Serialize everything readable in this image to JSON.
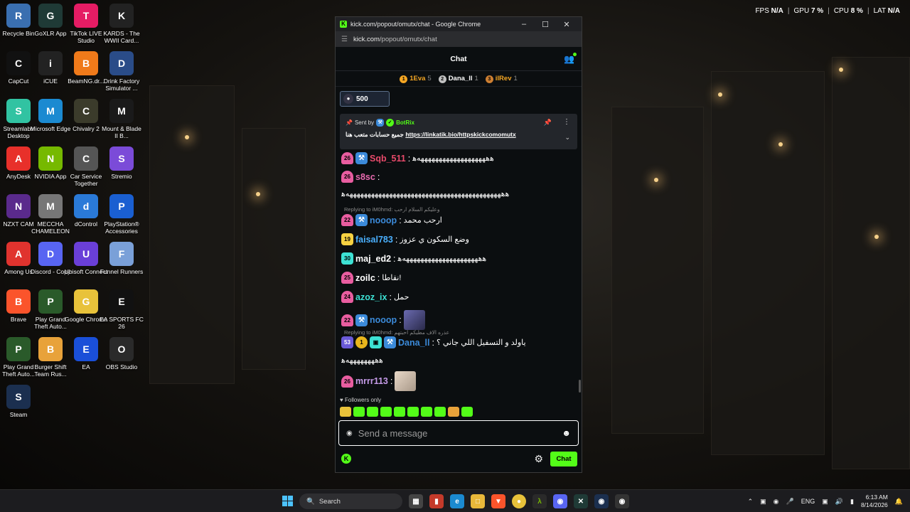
{
  "performance": {
    "fps_label": "FPS",
    "fps_value": "N/A",
    "gpu_label": "GPU",
    "gpu_value": "7 %",
    "cpu_label": "CPU",
    "cpu_value": "8 %",
    "lat_label": "LAT",
    "lat_value": "N/A"
  },
  "desktop": {
    "icons": [
      {
        "label": "Recycle Bin",
        "icon": "recycle-bin-icon",
        "color": "#3a6fb0"
      },
      {
        "label": "GoXLR App",
        "icon": "goxlr-icon",
        "color": "#1f3a36"
      },
      {
        "label": "TikTok LIVE Studio",
        "icon": "tiktok-icon",
        "color": "#e51c64"
      },
      {
        "label": "KARDS - The WWII Card...",
        "icon": "kards-icon",
        "color": "#222222"
      },
      {
        "label": "CapCut",
        "icon": "capcut-icon",
        "color": "#111111"
      },
      {
        "label": "iCUE",
        "icon": "icue-icon",
        "color": "#222222"
      },
      {
        "label": "BeamNG.dr...",
        "icon": "beamng-icon",
        "color": "#f07a1a"
      },
      {
        "label": "Drink Factory Simulator ...",
        "icon": "drink-factory-icon",
        "color": "#2a4c88"
      },
      {
        "label": "Streamlabs Desktop",
        "icon": "streamlabs-icon",
        "color": "#31c3a2"
      },
      {
        "label": "Microsoft Edge",
        "icon": "edge-icon",
        "color": "#1b8ad1"
      },
      {
        "label": "Chivalry 2",
        "icon": "chivalry-icon",
        "color": "#3b3b2b"
      },
      {
        "label": "Mount & Blade II B...",
        "icon": "bannerlord-icon",
        "color": "#1a1a1a"
      },
      {
        "label": "AnyDesk",
        "icon": "anydesk-icon",
        "color": "#e8302a"
      },
      {
        "label": "NVIDIA App",
        "icon": "nvidia-icon",
        "color": "#76b900"
      },
      {
        "label": "Car Service Together",
        "icon": "car-service-icon",
        "color": "#555555"
      },
      {
        "label": "Stremio",
        "icon": "stremio-icon",
        "color": "#7b4bd8"
      },
      {
        "label": "NZXT CAM",
        "icon": "nzxt-icon",
        "color": "#5a2a8c"
      },
      {
        "label": "MECCHA CHAMELEON",
        "icon": "meccha-icon",
        "color": "#777777"
      },
      {
        "label": "dControl",
        "icon": "dcontrol-icon",
        "color": "#2a7ad8"
      },
      {
        "label": "PlayStation® Accessories",
        "icon": "playstation-icon",
        "color": "#1a5fd1"
      },
      {
        "label": "Among Us",
        "icon": "among-us-icon",
        "color": "#e0332e"
      },
      {
        "label": "Discord - Copy",
        "icon": "discord-icon",
        "color": "#5865f2"
      },
      {
        "label": "Ubisoft Connect",
        "icon": "ubisoft-icon",
        "color": "#6a3fd8"
      },
      {
        "label": "Funnel Runners",
        "icon": "funnel-runners-icon",
        "color": "#7aa0d8"
      },
      {
        "label": "Brave",
        "icon": "brave-icon",
        "color": "#fb542b"
      },
      {
        "label": "Play Grand Theft Auto...",
        "icon": "gta-icon",
        "color": "#2a5a2a"
      },
      {
        "label": "Google Chrome",
        "icon": "chrome-icon",
        "color": "#e8c23a"
      },
      {
        "label": "EA SPORTS FC 26",
        "icon": "fc26-icon",
        "color": "#111111"
      },
      {
        "label": "Play Grand Theft Auto...",
        "icon": "gta-icon",
        "color": "#2a5a2a"
      },
      {
        "label": "Burger Shift Team Rus...",
        "icon": "burger-shift-icon",
        "color": "#e8a23a"
      },
      {
        "label": "EA",
        "icon": "ea-icon",
        "color": "#1a4fd8"
      },
      {
        "label": "OBS Studio",
        "icon": "obs-icon",
        "color": "#2a2a2a"
      },
      {
        "label": "Steam",
        "icon": "steam-icon",
        "color": "#1b2f4f"
      }
    ]
  },
  "browser": {
    "window_title": "kick.com/popout/omutx/chat - Google Chrome",
    "url_host": "kick.com",
    "url_path": "/popout/omutx/chat"
  },
  "chat": {
    "header_title": "Chat",
    "leaderboard": [
      {
        "rank": "1",
        "name": "1Eva",
        "count": "5",
        "color": "#f5a623",
        "rank_color": "#f5a623"
      },
      {
        "rank": "2",
        "name": "Dana_ll",
        "count": "1",
        "color": "#ffffff",
        "rank_color": "#c0c0c0"
      },
      {
        "rank": "3",
        "name": "ilRev",
        "count": "1",
        "color": "#f5a623",
        "rank_color": "#cd7f32"
      }
    ],
    "goal_value": "500",
    "pinned": {
      "sent_by": "Sent by",
      "bot_name": "BotRix",
      "text": "جميع حسابات متعب هنا",
      "link": "https://linkatik.bio/httpskickcomomutx"
    },
    "messages": [
      {
        "badges": [
          {
            "t": "26",
            "c": "b-pink"
          },
          {
            "t": "⚒",
            "c": "b-mod"
          }
        ],
        "user": "Sqb_511",
        "color": "#e84a6a",
        "text": "ﻫههههههههههههههههههههﻫ"
      },
      {
        "badges": [
          {
            "t": "26",
            "c": "b-pink"
          }
        ],
        "user": "s8sc",
        "color": "#e86ab0",
        "text": ""
      },
      {
        "continuation": "ﻫههههههههههههههههههههههههههههههههههههههههههههﻫ"
      },
      {
        "reply": "Replying to iM0hmd: وعليكم السلام ارحب"
      },
      {
        "badges": [
          {
            "t": "22",
            "c": "b-pink"
          },
          {
            "t": "⚒",
            "c": "b-mod"
          }
        ],
        "user": "nooop",
        "color": "#3b8ad9",
        "text": "ارحب محمد"
      },
      {
        "badges": [
          {
            "t": "19",
            "c": "b-yellow"
          }
        ],
        "user": "faisal783",
        "color": "#4ab0ff",
        "text": "وضع السكون ي عزوز"
      },
      {
        "badges": [
          {
            "t": "30",
            "c": "b-cyan"
          }
        ],
        "user": "maj_ed2",
        "color": "#ffffff",
        "text": "ﻫههههههههههههههههههههههﻫ"
      },
      {
        "badges": [
          {
            "t": "25",
            "c": "b-pink"
          }
        ],
        "user": "zoilc",
        "color": "#ffffff",
        "text": "نقاطا!"
      },
      {
        "badges": [
          {
            "t": "24",
            "c": "b-pink"
          }
        ],
        "user": "azoz_ix",
        "color": "#3de1d4",
        "text": "حمل"
      },
      {
        "badges": [
          {
            "t": "22",
            "c": "b-pink"
          },
          {
            "t": "⚒",
            "c": "b-mod"
          }
        ],
        "user": "nooop",
        "color": "#3b8ad9",
        "text": ""
      },
      {
        "reply": "Replying to iM0hmd: عذره الاف مطيكم احبتهم"
      },
      {
        "badges": [
          {
            "t": "53",
            "c": "b-purple"
          },
          {
            "t": "1",
            "c": "b-gold"
          },
          {
            "t": "▣",
            "c": "b-gift"
          },
          {
            "t": "⚒",
            "c": "b-mod"
          }
        ],
        "user": "Dana_ll",
        "color": "#3b8ad9",
        "text": "ياولد و التسفيل اللي جاني ؟"
      },
      {
        "continuation": "ﻫهههههههههﻫ"
      },
      {
        "badges": [
          {
            "t": "26",
            "c": "b-pink"
          }
        ],
        "user": "mrrr113",
        "color": "#c59be8",
        "text": ""
      }
    ],
    "followers_only": "Followers only",
    "input_placeholder": "Send a message",
    "send_label": "Chat"
  },
  "taskbar": {
    "search_label": "Search",
    "language": "ENG",
    "time": "6:13 AM",
    "date": "8/14/2026"
  }
}
